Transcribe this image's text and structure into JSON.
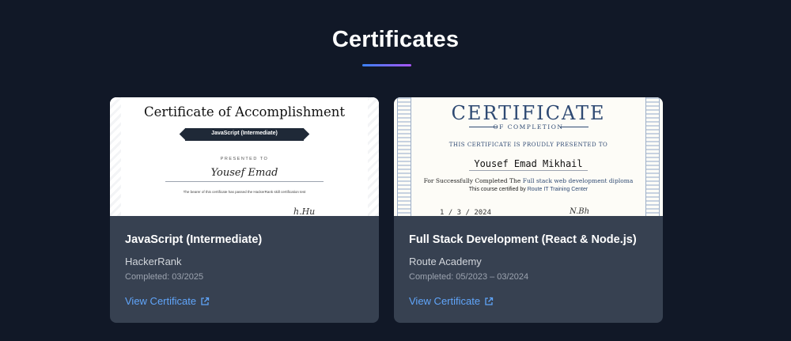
{
  "section": {
    "title": "Certificates"
  },
  "cards": [
    {
      "title": "JavaScript (Intermediate)",
      "issuer": "HackerRank",
      "date": "Completed: 03/2025",
      "link_label": "View Certificate",
      "preview": {
        "heading": "Certificate of Accomplishment",
        "ribbon": "JavaScript (Intermediate)",
        "presented_to": "PRESENTED TO",
        "name": "Yousef Emad",
        "description": "The bearer of this certificate has passed the HackerRank skill certification test",
        "signature": "h.Hu"
      }
    },
    {
      "title": "Full Stack Development (React & Node.js)",
      "issuer": "Route Academy",
      "date": "Completed: 05/2023 – 03/2024",
      "link_label": "View Certificate",
      "preview": {
        "heading": "CERTIFICATE",
        "subheading": "OF COMPLETION",
        "proudly": "THIS CERTIFICATE IS PROUDLY PRESENTED TO",
        "name": "Yousef Emad Mikhail",
        "completed_prefix": "For Successfully Completed The",
        "completed_course": "Full stack web development diploma",
        "certified_prefix": "This course certified by",
        "certified_org": "Route IT Training Center",
        "date": "1 / 3 / 2024",
        "signature": "N.Bh"
      }
    }
  ],
  "colors": {
    "background": "#111827",
    "card": "#374151",
    "link": "#60a5fa",
    "accent_start": "#3b82f6",
    "accent_end": "#a855f7"
  },
  "icons": {
    "external_link": "external-link-icon"
  }
}
